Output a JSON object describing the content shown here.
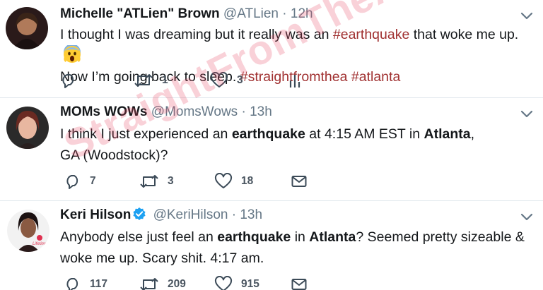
{
  "tweets": [
    {
      "name": "Michelle \"ATLien\" Brown",
      "handle": "@ATLien",
      "sep": "·",
      "time": "12h",
      "verified": false,
      "text_parts": [
        {
          "t": "I thought I was dreaming but it really was an ",
          "s": "plain"
        },
        {
          "t": "#earthquake",
          "s": "tag"
        },
        {
          "t": " that woke me up. ",
          "s": "plain"
        },
        {
          "t": "Now I’m going back to sleep. ",
          "s": "plain"
        },
        {
          "t": "#straightfromthea",
          "s": "tag"
        },
        {
          "t": " ",
          "s": "plain"
        },
        {
          "t": "#atlanta",
          "s": "tag"
        }
      ],
      "reply_count": "",
      "retweet_count": "1",
      "like_count": "3",
      "last_icon": "analytics-icon"
    },
    {
      "name": "MOMs WOWs",
      "handle": "@MomsWows",
      "sep": "·",
      "time": "13h",
      "verified": false,
      "text_parts": [
        {
          "t": "I think I just experienced an ",
          "s": "plain"
        },
        {
          "t": "earthquake",
          "s": "bold"
        },
        {
          "t": " at 4:15 AM EST in ",
          "s": "plain"
        },
        {
          "t": "Atlanta",
          "s": "bold"
        },
        {
          "t": ", GA (Woodstock)?",
          "s": "plain"
        }
      ],
      "reply_count": "7",
      "retweet_count": "3",
      "like_count": "18",
      "last_icon": "message-icon"
    },
    {
      "name": "Keri Hilson",
      "handle": "@KeriHilson",
      "sep": "·",
      "time": "13h",
      "verified": true,
      "text_parts": [
        {
          "t": "Anybody else just feel an ",
          "s": "plain"
        },
        {
          "t": "earthquake",
          "s": "bold"
        },
        {
          "t": " in ",
          "s": "plain"
        },
        {
          "t": "Atlanta",
          "s": "bold"
        },
        {
          "t": "? Seemed pretty sizeable & woke me up. Scary shit. 4:17 am.",
          "s": "plain"
        }
      ],
      "reply_count": "117",
      "retweet_count": "209",
      "like_count": "915",
      "last_icon": "message-icon"
    }
  ],
  "avatar_badge": "Lifetime",
  "watermark": "StraightFromTheA.com",
  "colors": {
    "text": "#14171a",
    "meta": "#657786",
    "hashtag": "#a03030",
    "icon": "#3b4a57",
    "divider": "#e1e8ed",
    "verified": "#1da1f2",
    "watermark": "#e84664"
  }
}
